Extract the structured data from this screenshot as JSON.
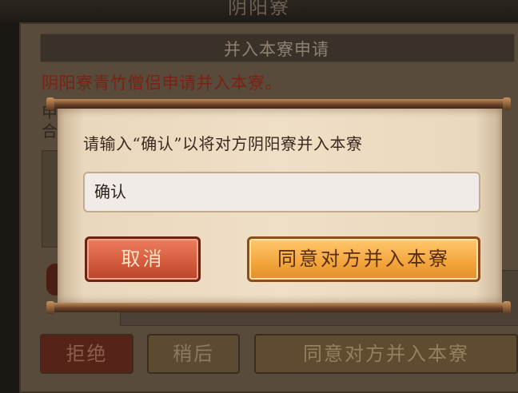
{
  "background": {
    "window_title": "阴阳寮",
    "header_title": "并入本寮申请",
    "request_text": "阴阳寮青竹僧侣申请并入本寮。",
    "line_start_1": "申",
    "line_start_2": "合",
    "buttons": {
      "reject": "拒绝",
      "later": "稍后",
      "agree": "同意对方并入本寮"
    }
  },
  "dialog": {
    "prompt": "请输入“确认”以将对方阴阳寮并入本寮",
    "input_value": "确认",
    "cancel_label": "取消",
    "confirm_label": "同意对方并入本寮"
  },
  "colors": {
    "cancel_button": "#d35a3c",
    "confirm_button": "#f3a53c",
    "request_text": "#7c2215",
    "scroll_paper": "#efdfc6"
  }
}
